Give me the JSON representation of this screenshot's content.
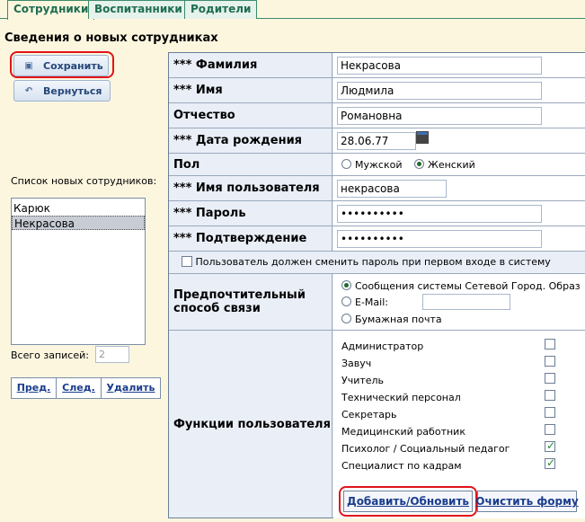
{
  "tabs": [
    {
      "label": "Сотрудники",
      "active": true
    },
    {
      "label": "Воспитанники",
      "active": false
    },
    {
      "label": "Родители",
      "active": false
    }
  ],
  "page_title": "Сведения о новых сотрудниках",
  "left_panel": {
    "save_label": "Сохранить",
    "back_label": "Вернуться",
    "list_label": "Список новых сотрудников:",
    "list_items": [
      "Карюк",
      "Некрасова"
    ],
    "selected_item": "Некрасова",
    "total_label": "Всего записей:",
    "total_value": "2",
    "nav": {
      "prev": "Пред.",
      "next": "След.",
      "delete": "Удалить"
    }
  },
  "form": {
    "surname": {
      "label": "*** Фамилия",
      "value": "Некрасова"
    },
    "name": {
      "label": "*** Имя",
      "value": "Людмила"
    },
    "patronymic": {
      "label": "Отчество",
      "value": "Романовна"
    },
    "birthdate": {
      "label": "*** Дата рождения",
      "value": "28.06.77"
    },
    "gender": {
      "label": "Пол",
      "male": "Мужской",
      "female": "Женский",
      "selected": "Женский"
    },
    "username": {
      "label": "*** Имя пользователя",
      "value": "некрасова"
    },
    "password": {
      "label": "*** Пароль",
      "value": "••••••••••"
    },
    "confirm": {
      "label": "*** Подтверждение",
      "value": "••••••••••"
    },
    "must_change_label": "Пользователь должен сменить пароль при первом входе в систему",
    "must_change_checked": false,
    "contact": {
      "label_line1": "Предпочтительный",
      "label_line2": "способ связи",
      "opt_system": "Сообщения системы Сетевой Город. Образ",
      "opt_email": "E-Mail:",
      "email_value": "",
      "opt_paper": "Бумажная почта",
      "selected": "Сообщения системы Сетевой Город. Образ"
    },
    "functions": {
      "label": "Функции пользователя",
      "items": [
        {
          "label": "Администратор",
          "checked": false
        },
        {
          "label": "Завуч",
          "checked": false
        },
        {
          "label": "Учитель",
          "checked": false
        },
        {
          "label": "Технический персонал",
          "checked": false
        },
        {
          "label": "Секретарь",
          "checked": false
        },
        {
          "label": "Медицинский работник",
          "checked": false
        },
        {
          "label": "Психолог / Социальный педагог",
          "checked": true
        },
        {
          "label": "Специалист по кадрам",
          "checked": true
        }
      ]
    },
    "add_update_label": "Добавить/Обновить",
    "clear_label": "Очистить форму"
  },
  "colors": {
    "highlight": "#e0141a",
    "tab_green": "#1f6e52",
    "page_bg": "#fdf6df"
  }
}
